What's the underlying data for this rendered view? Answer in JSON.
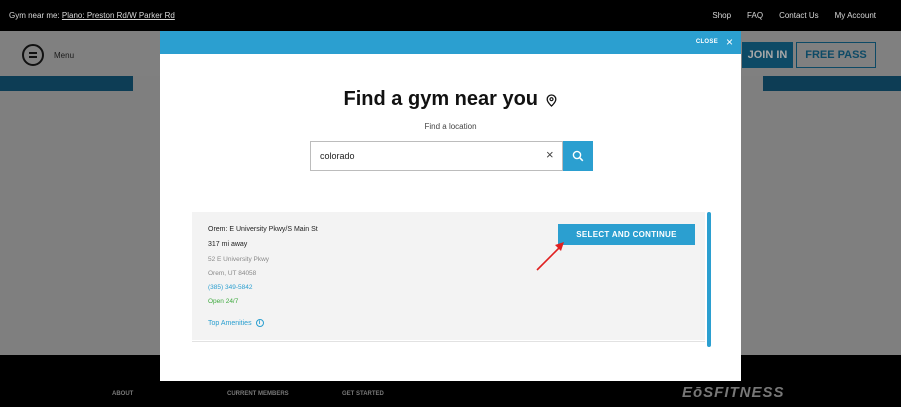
{
  "topbar": {
    "near_prefix": "Gym near me:",
    "near_location": "Plano: Preston Rd/W Parker Rd",
    "links": [
      "Shop",
      "FAQ",
      "Contact Us",
      "My Account"
    ]
  },
  "nav": {
    "menu_label": "Menu",
    "join_label": "JOIN IN",
    "free_pass_label": "FREE PASS"
  },
  "footer": {
    "links": [
      "ABOUT",
      "CURRENT MEMBERS",
      "GET STARTED"
    ],
    "brand": "EōSFITNESS"
  },
  "modal": {
    "close_label": "CLOSE",
    "close_icon": "×",
    "title": "Find a gym near you",
    "subtitle": "Find a location",
    "search": {
      "value": "colorado",
      "clear_icon": "×"
    },
    "result": {
      "name": "Orem: E University Pkwy/S Main St",
      "distance": "317 mi away",
      "street": "52 E University Pkwy",
      "city": "Orem, UT 84058",
      "phone": "(385) 349-5842",
      "hours": "Open 24/7",
      "amenities_label": "Top Amenities",
      "select_label": "SELECT AND CONTINUE"
    }
  },
  "colors": {
    "accent": "#2b9fd0",
    "open_green": "#3faa3f",
    "annotation_red": "#e02020"
  }
}
